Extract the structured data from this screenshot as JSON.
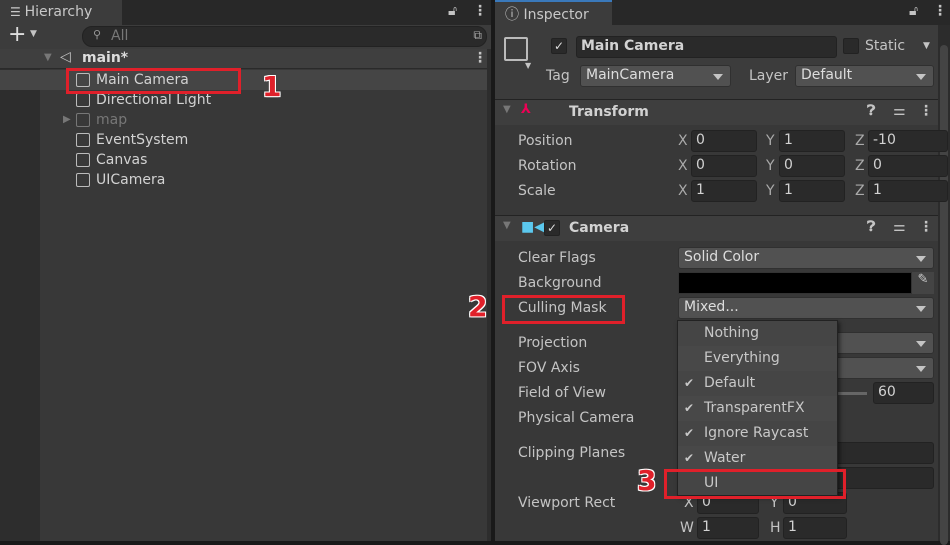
{
  "hierarchy": {
    "tab": "Hierarchy",
    "search_placeholder": "All",
    "scene": "main*",
    "items": [
      {
        "label": "Main Camera",
        "selected": true
      },
      {
        "label": "Directional Light"
      },
      {
        "label": "map",
        "inactive": true,
        "expandable": true
      },
      {
        "label": "EventSystem"
      },
      {
        "label": "Canvas"
      },
      {
        "label": "UICamera"
      }
    ]
  },
  "inspector": {
    "tab": "Inspector",
    "object_name": "Main Camera",
    "active": true,
    "static_label": "Static",
    "tag_label": "Tag",
    "tag_value": "MainCamera",
    "layer_label": "Layer",
    "layer_value": "Default",
    "transform": {
      "title": "Transform",
      "rows": [
        {
          "label": "Position",
          "x": "0",
          "y": "1",
          "z": "-10"
        },
        {
          "label": "Rotation",
          "x": "0",
          "y": "0",
          "z": "0"
        },
        {
          "label": "Scale",
          "x": "1",
          "y": "1",
          "z": "1"
        }
      ]
    },
    "camera": {
      "title": "Camera",
      "enabled": true,
      "clear_flags_label": "Clear Flags",
      "clear_flags": "Solid Color",
      "background_label": "Background",
      "background_color": "#000000",
      "culling_mask_label": "Culling Mask",
      "culling_mask": "Mixed...",
      "projection_label": "Projection",
      "fov_axis_label": "FOV Axis",
      "fov_label": "Field of View",
      "fov_value": "60",
      "physical_label": "Physical Camera",
      "clipping_label": "Clipping Planes",
      "viewport_label": "Viewport Rect",
      "vx": "0",
      "vy": "0",
      "vw": "1",
      "vh": "1"
    }
  },
  "culling_menu": {
    "items": [
      {
        "label": "Nothing",
        "checked": false
      },
      {
        "label": "Everything",
        "checked": false
      },
      {
        "label": "Default",
        "checked": true
      },
      {
        "label": "TransparentFX",
        "checked": true
      },
      {
        "label": "Ignore Raycast",
        "checked": true
      },
      {
        "label": "Water",
        "checked": true
      },
      {
        "label": "UI",
        "checked": false
      }
    ]
  },
  "annotations": {
    "n1": "1",
    "n2": "2",
    "n3": "3"
  },
  "colors": {
    "highlight": "#e0202a",
    "selection_tab": "#3a79bb"
  }
}
